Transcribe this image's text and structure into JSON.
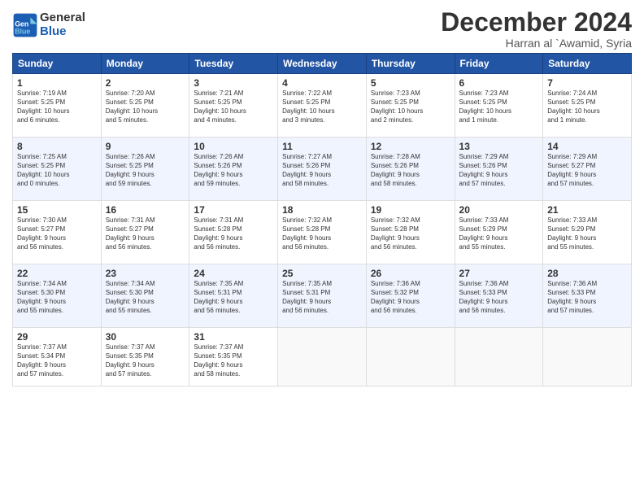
{
  "header": {
    "logo_text_general": "General",
    "logo_text_blue": "Blue",
    "month_title": "December 2024",
    "location": "Harran al `Awamid, Syria"
  },
  "days_of_week": [
    "Sunday",
    "Monday",
    "Tuesday",
    "Wednesday",
    "Thursday",
    "Friday",
    "Saturday"
  ],
  "weeks": [
    [
      {
        "day": 1,
        "lines": [
          "Sunrise: 7:19 AM",
          "Sunset: 5:25 PM",
          "Daylight: 10 hours",
          "and 6 minutes."
        ]
      },
      {
        "day": 2,
        "lines": [
          "Sunrise: 7:20 AM",
          "Sunset: 5:25 PM",
          "Daylight: 10 hours",
          "and 5 minutes."
        ]
      },
      {
        "day": 3,
        "lines": [
          "Sunrise: 7:21 AM",
          "Sunset: 5:25 PM",
          "Daylight: 10 hours",
          "and 4 minutes."
        ]
      },
      {
        "day": 4,
        "lines": [
          "Sunrise: 7:22 AM",
          "Sunset: 5:25 PM",
          "Daylight: 10 hours",
          "and 3 minutes."
        ]
      },
      {
        "day": 5,
        "lines": [
          "Sunrise: 7:23 AM",
          "Sunset: 5:25 PM",
          "Daylight: 10 hours",
          "and 2 minutes."
        ]
      },
      {
        "day": 6,
        "lines": [
          "Sunrise: 7:23 AM",
          "Sunset: 5:25 PM",
          "Daylight: 10 hours",
          "and 1 minute."
        ]
      },
      {
        "day": 7,
        "lines": [
          "Sunrise: 7:24 AM",
          "Sunset: 5:25 PM",
          "Daylight: 10 hours",
          "and 1 minute."
        ]
      }
    ],
    [
      {
        "day": 8,
        "lines": [
          "Sunrise: 7:25 AM",
          "Sunset: 5:25 PM",
          "Daylight: 10 hours",
          "and 0 minutes."
        ]
      },
      {
        "day": 9,
        "lines": [
          "Sunrise: 7:26 AM",
          "Sunset: 5:25 PM",
          "Daylight: 9 hours",
          "and 59 minutes."
        ]
      },
      {
        "day": 10,
        "lines": [
          "Sunrise: 7:26 AM",
          "Sunset: 5:26 PM",
          "Daylight: 9 hours",
          "and 59 minutes."
        ]
      },
      {
        "day": 11,
        "lines": [
          "Sunrise: 7:27 AM",
          "Sunset: 5:26 PM",
          "Daylight: 9 hours",
          "and 58 minutes."
        ]
      },
      {
        "day": 12,
        "lines": [
          "Sunrise: 7:28 AM",
          "Sunset: 5:26 PM",
          "Daylight: 9 hours",
          "and 58 minutes."
        ]
      },
      {
        "day": 13,
        "lines": [
          "Sunrise: 7:29 AM",
          "Sunset: 5:26 PM",
          "Daylight: 9 hours",
          "and 57 minutes."
        ]
      },
      {
        "day": 14,
        "lines": [
          "Sunrise: 7:29 AM",
          "Sunset: 5:27 PM",
          "Daylight: 9 hours",
          "and 57 minutes."
        ]
      }
    ],
    [
      {
        "day": 15,
        "lines": [
          "Sunrise: 7:30 AM",
          "Sunset: 5:27 PM",
          "Daylight: 9 hours",
          "and 56 minutes."
        ]
      },
      {
        "day": 16,
        "lines": [
          "Sunrise: 7:31 AM",
          "Sunset: 5:27 PM",
          "Daylight: 9 hours",
          "and 56 minutes."
        ]
      },
      {
        "day": 17,
        "lines": [
          "Sunrise: 7:31 AM",
          "Sunset: 5:28 PM",
          "Daylight: 9 hours",
          "and 56 minutes."
        ]
      },
      {
        "day": 18,
        "lines": [
          "Sunrise: 7:32 AM",
          "Sunset: 5:28 PM",
          "Daylight: 9 hours",
          "and 56 minutes."
        ]
      },
      {
        "day": 19,
        "lines": [
          "Sunrise: 7:32 AM",
          "Sunset: 5:28 PM",
          "Daylight: 9 hours",
          "and 56 minutes."
        ]
      },
      {
        "day": 20,
        "lines": [
          "Sunrise: 7:33 AM",
          "Sunset: 5:29 PM",
          "Daylight: 9 hours",
          "and 55 minutes."
        ]
      },
      {
        "day": 21,
        "lines": [
          "Sunrise: 7:33 AM",
          "Sunset: 5:29 PM",
          "Daylight: 9 hours",
          "and 55 minutes."
        ]
      }
    ],
    [
      {
        "day": 22,
        "lines": [
          "Sunrise: 7:34 AM",
          "Sunset: 5:30 PM",
          "Daylight: 9 hours",
          "and 55 minutes."
        ]
      },
      {
        "day": 23,
        "lines": [
          "Sunrise: 7:34 AM",
          "Sunset: 5:30 PM",
          "Daylight: 9 hours",
          "and 55 minutes."
        ]
      },
      {
        "day": 24,
        "lines": [
          "Sunrise: 7:35 AM",
          "Sunset: 5:31 PM",
          "Daylight: 9 hours",
          "and 56 minutes."
        ]
      },
      {
        "day": 25,
        "lines": [
          "Sunrise: 7:35 AM",
          "Sunset: 5:31 PM",
          "Daylight: 9 hours",
          "and 56 minutes."
        ]
      },
      {
        "day": 26,
        "lines": [
          "Sunrise: 7:36 AM",
          "Sunset: 5:32 PM",
          "Daylight: 9 hours",
          "and 56 minutes."
        ]
      },
      {
        "day": 27,
        "lines": [
          "Sunrise: 7:36 AM",
          "Sunset: 5:33 PM",
          "Daylight: 9 hours",
          "and 56 minutes."
        ]
      },
      {
        "day": 28,
        "lines": [
          "Sunrise: 7:36 AM",
          "Sunset: 5:33 PM",
          "Daylight: 9 hours",
          "and 57 minutes."
        ]
      }
    ],
    [
      {
        "day": 29,
        "lines": [
          "Sunrise: 7:37 AM",
          "Sunset: 5:34 PM",
          "Daylight: 9 hours",
          "and 57 minutes."
        ]
      },
      {
        "day": 30,
        "lines": [
          "Sunrise: 7:37 AM",
          "Sunset: 5:35 PM",
          "Daylight: 9 hours",
          "and 57 minutes."
        ]
      },
      {
        "day": 31,
        "lines": [
          "Sunrise: 7:37 AM",
          "Sunset: 5:35 PM",
          "Daylight: 9 hours",
          "and 58 minutes."
        ]
      },
      null,
      null,
      null,
      null
    ]
  ]
}
